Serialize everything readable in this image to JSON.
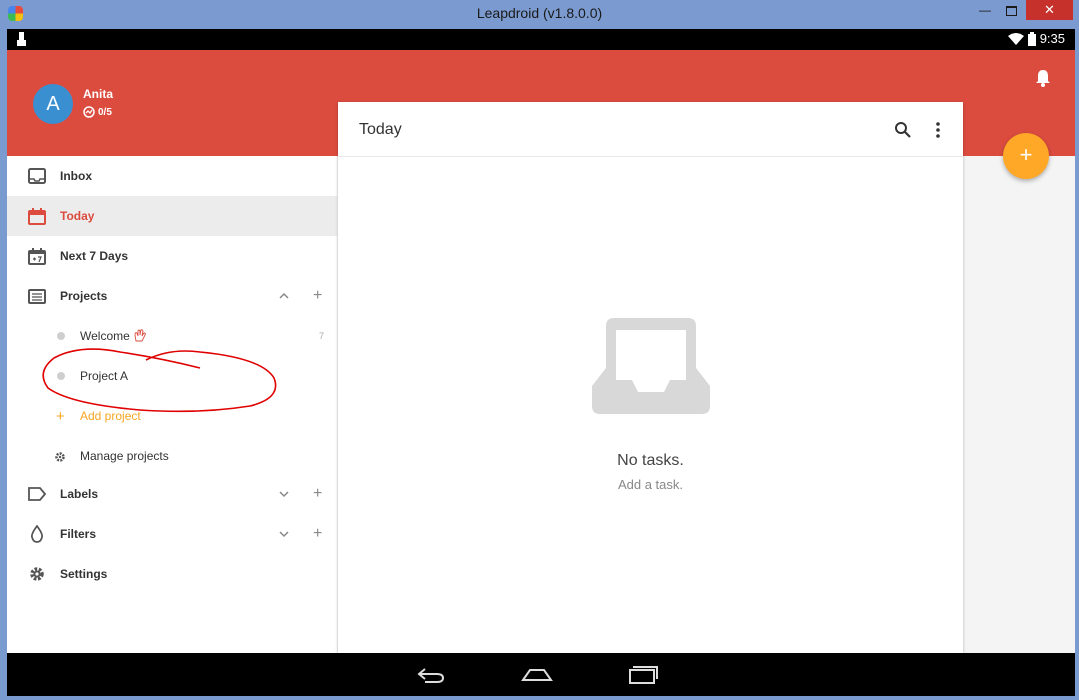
{
  "window": {
    "title": "Leapdroid (v1.8.0.0)",
    "minimize_glyph": "—",
    "close_glyph": "✕"
  },
  "status_bar": {
    "time": "9:35"
  },
  "profile": {
    "avatar_letter": "A",
    "name": "Anita",
    "karma": "0/5"
  },
  "sidebar": {
    "items": {
      "inbox": "Inbox",
      "today": "Today",
      "next7": "Next 7 Days",
      "projects": "Projects",
      "labels": "Labels",
      "filters": "Filters",
      "settings": "Settings"
    },
    "projects": {
      "welcome": {
        "label": "Welcome",
        "count": "7"
      },
      "project_a": {
        "label": "Project A"
      },
      "add_project": "Add project",
      "manage_projects": "Manage projects"
    },
    "plus_glyph": "+"
  },
  "main": {
    "title": "Today",
    "empty_title": "No tasks.",
    "empty_subtitle": "Add a task."
  },
  "fab": {
    "glyph": "+"
  },
  "colors": {
    "brand_red": "#db4c3f",
    "fab_orange": "#ffa726",
    "avatar_blue": "#3a8fd1",
    "annotation_red": "#e00000"
  },
  "icons": [
    "app-icon",
    "wifi-icon",
    "battery-icon",
    "bell-icon",
    "inbox-icon",
    "calendar-icon",
    "calendar-7-icon",
    "projects-icon",
    "gear-icon",
    "label-icon",
    "drop-icon",
    "chevron-up-icon",
    "chevron-down-icon",
    "search-icon",
    "more-vert-icon",
    "empty-inbox-icon",
    "back-icon",
    "home-icon",
    "recents-icon"
  ]
}
